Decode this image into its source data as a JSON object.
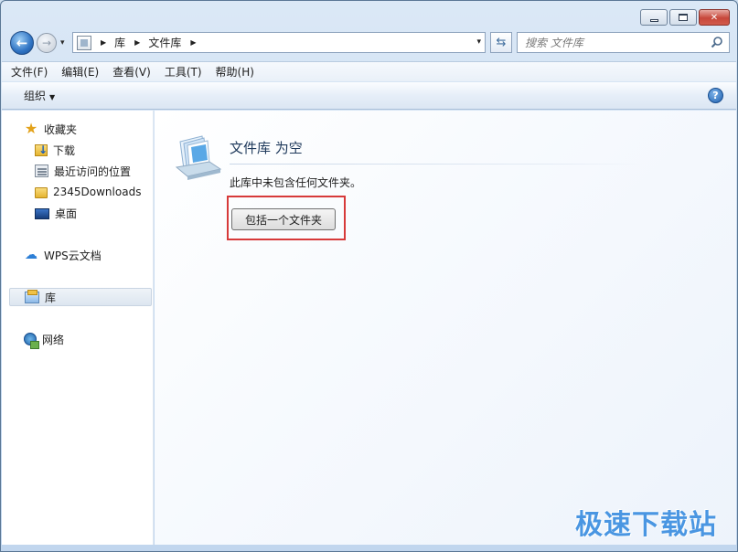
{
  "window": {
    "controls": {
      "minimize_icon": "minimize-icon",
      "maximize_icon": "maximize-icon",
      "close_icon": "close-icon",
      "close_label": "✕"
    }
  },
  "nav": {
    "back_glyph": "←",
    "forward_glyph": "→",
    "history_drop_glyph": "▾",
    "breadcrumbs": [
      "库",
      "文件库"
    ],
    "crumb_sep": "▶",
    "address_drop_glyph": "▾",
    "refresh_glyph": "⇆",
    "search_placeholder": "搜索 文件库"
  },
  "menubar": {
    "items": [
      "文件(F)",
      "编辑(E)",
      "查看(V)",
      "工具(T)",
      "帮助(H)"
    ]
  },
  "cmdbar": {
    "organize_label": "组织",
    "organize_caret": "▼",
    "help_glyph": "?"
  },
  "sidebar": {
    "favorites": {
      "label": "收藏夹",
      "items": [
        {
          "label": "下载",
          "icon": "download-folder-icon"
        },
        {
          "label": "最近访问的位置",
          "icon": "recent-places-icon"
        },
        {
          "label": "2345Downloads",
          "icon": "folder-icon"
        },
        {
          "label": "桌面",
          "icon": "desktop-icon"
        }
      ]
    },
    "wps_cloud": {
      "label": "WPS云文档",
      "icon": "cloud-icon"
    },
    "libraries": {
      "label": "库",
      "icon": "library-icon",
      "selected": true
    },
    "network": {
      "label": "网络",
      "icon": "network-icon"
    }
  },
  "content": {
    "title": "文件库 为空",
    "description": "此库中未包含任何文件夹。",
    "include_button_label": "包括一个文件夹",
    "highlight_color": "#d73a3a"
  },
  "watermark": "极速下载站",
  "colors": {
    "accent": "#2f73c3",
    "title_text": "#1e395b",
    "watermark": "#3d8fe0"
  }
}
